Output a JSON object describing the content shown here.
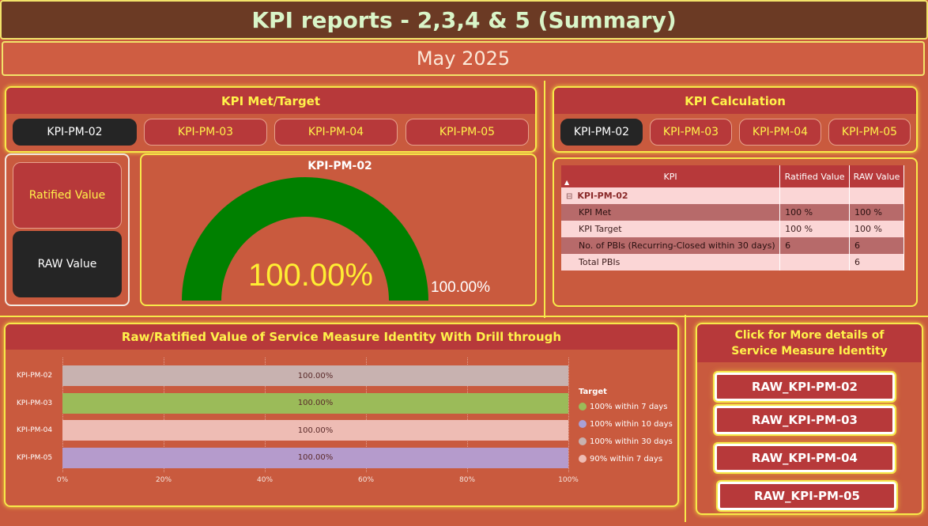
{
  "header": {
    "title": "KPI reports - 2,3,4 & 5 (Summary)",
    "period": "May 2025"
  },
  "kpi_met_target": {
    "title": "KPI Met/Target",
    "tabs": [
      "KPI-PM-02",
      "KPI-PM-03",
      "KPI-PM-04",
      "KPI-PM-05"
    ],
    "active_tab": "KPI-PM-02"
  },
  "value_toggle": {
    "ratified_label": "Ratified Value",
    "raw_label": "RAW Value"
  },
  "gauge": {
    "title": "KPI-PM-02",
    "value_text": "100.00%",
    "target_text": "100.00%",
    "value": 100,
    "max": 100
  },
  "kpi_calc": {
    "title": "KPI Calculation",
    "tabs": [
      "KPI-PM-02",
      "KPI-PM-03",
      "KPI-PM-04",
      "KPI-PM-05"
    ],
    "active_tab": "KPI-PM-02",
    "table": {
      "columns": [
        "KPI",
        "Ratified Value",
        "RAW Value"
      ],
      "group_label": "KPI-PM-02",
      "collapse_symbol": "⊟",
      "sort_symbol": "▲",
      "rows": [
        {
          "kpi": "KPI Met",
          "ratified": "100 %",
          "raw": "100 %"
        },
        {
          "kpi": "KPI Target",
          "ratified": "100 %",
          "raw": "100 %"
        },
        {
          "kpi": "No. of PBIs (Recurring-Closed within 30 days)",
          "ratified": "6",
          "raw": "6"
        },
        {
          "kpi": "Total PBIs",
          "ratified": "",
          "raw": "6"
        }
      ]
    }
  },
  "drill_chart": {
    "title": "Raw/Ratified Value of Service Measure Identity With Drill through",
    "legend_title": "Target",
    "legend": [
      {
        "label": "100% within 7 days",
        "color": "#9bbb59"
      },
      {
        "label": "100% within 10 days",
        "color": "#a9a0d6"
      },
      {
        "label": "100% within 30 days",
        "color": "#c8b2b0"
      },
      {
        "label": "90% within 7 days",
        "color": "#eebcb4"
      }
    ]
  },
  "chart_data": {
    "type": "bar",
    "orientation": "horizontal",
    "categories": [
      "KPI-PM-02",
      "KPI-PM-03",
      "KPI-PM-04",
      "KPI-PM-05"
    ],
    "values": [
      100,
      100,
      100,
      100
    ],
    "value_labels": [
      "100.00%",
      "100.00%",
      "100.00%",
      "100.00%"
    ],
    "colors": [
      "#c8b2b0",
      "#9bbb59",
      "#eebcb4",
      "#b59bcc"
    ],
    "x_ticks": [
      "0%",
      "20%",
      "40%",
      "60%",
      "80%",
      "100%"
    ],
    "xlim": [
      0,
      100
    ],
    "grid": true,
    "legend_placement": "right"
  },
  "more_details": {
    "title": "Click for More details of Service Measure Identity",
    "buttons": [
      "RAW_KPI-PM-02",
      "RAW_KPI-PM-03",
      "RAW_KPI-PM-04",
      "RAW_KPI-PM-05"
    ]
  }
}
